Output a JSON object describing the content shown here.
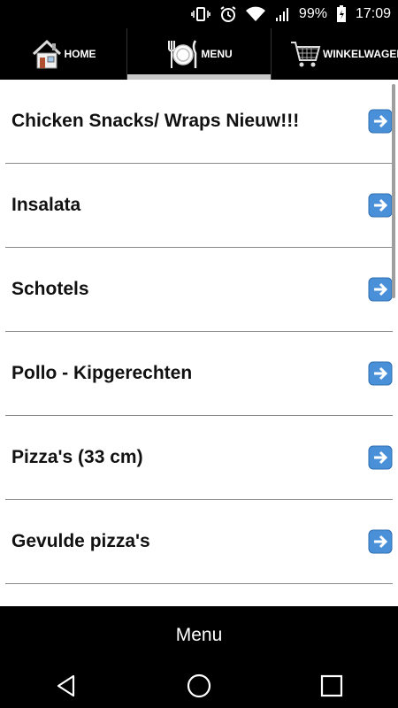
{
  "status_bar": {
    "battery_percent": "99%",
    "time": "17:09"
  },
  "top_nav": {
    "tabs": [
      {
        "label": "HOME"
      },
      {
        "label": "MENU"
      },
      {
        "label": "WINKELWAGEN"
      }
    ]
  },
  "menu_items": [
    {
      "label": "Chicken Snacks/ Wraps Nieuw!!!"
    },
    {
      "label": "Insalata"
    },
    {
      "label": "Schotels"
    },
    {
      "label": "Pollo - Kipgerechten"
    },
    {
      "label": "Pizza's (33 cm)"
    },
    {
      "label": "Gevulde pizza's"
    }
  ],
  "bottom_bar": {
    "title": "Menu"
  },
  "colors": {
    "bar_bg": "#000000",
    "active_tab_indicator": "#c8c8c8",
    "arrow_button": "#4a90d9",
    "divider": "#8a8a8a"
  }
}
